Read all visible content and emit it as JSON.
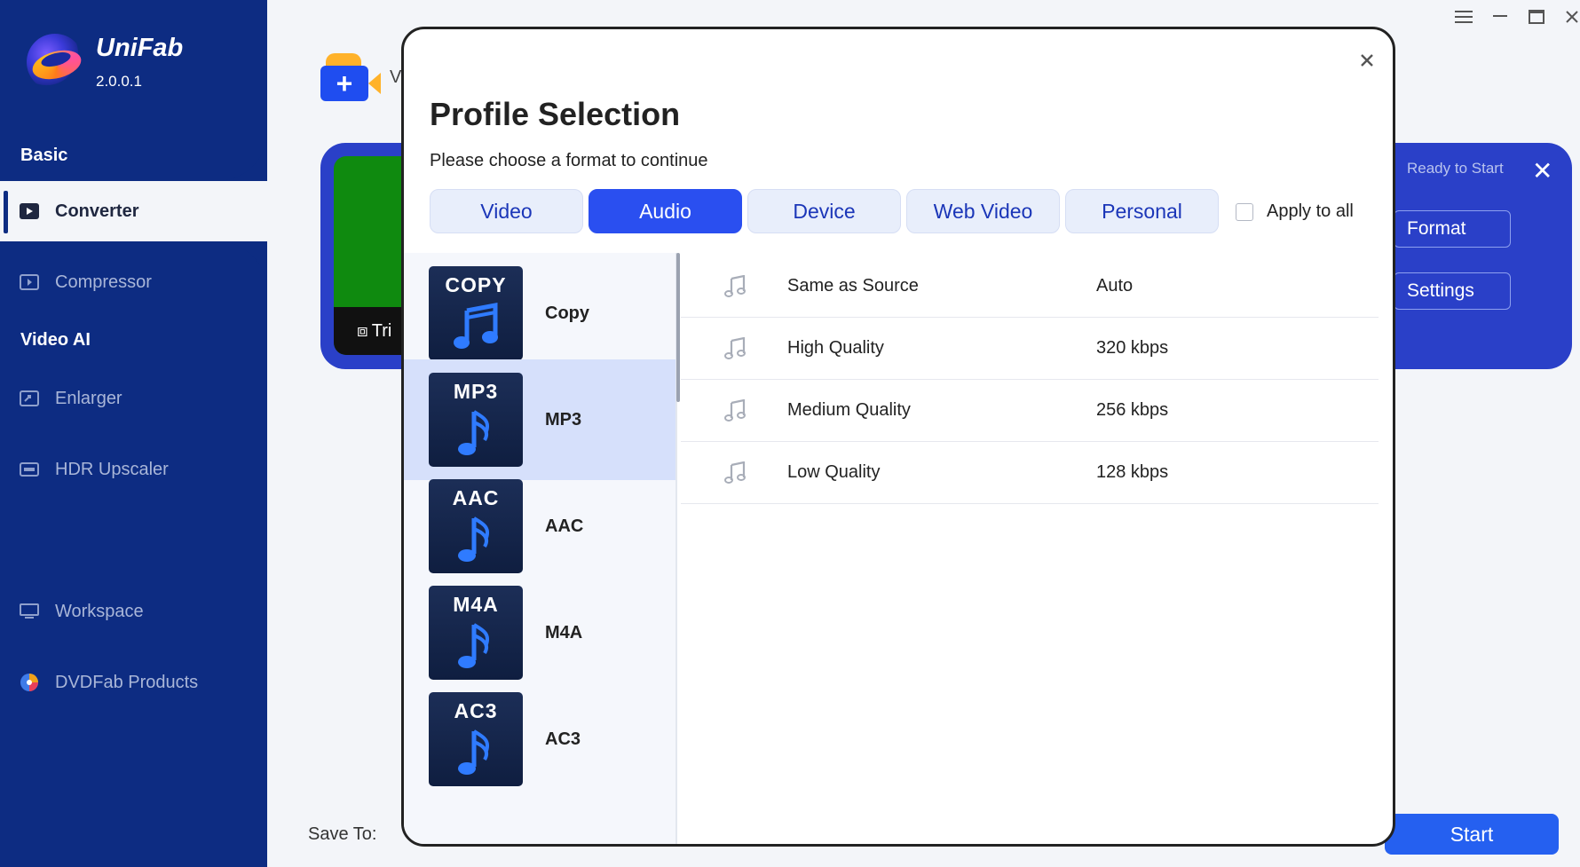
{
  "app": {
    "name": "UniFab",
    "version": "2.0.0.1"
  },
  "sidebar": {
    "sections": [
      {
        "title": "Basic",
        "items": [
          {
            "label": "Converter",
            "icon": "converter-icon"
          },
          {
            "label": "Compressor",
            "icon": "compressor-icon"
          }
        ]
      },
      {
        "title": "Video AI",
        "items": [
          {
            "label": "Enlarger",
            "icon": "enlarger-icon"
          },
          {
            "label": "HDR Upscaler",
            "icon": "hdr-icon"
          }
        ]
      }
    ],
    "bottom_items": [
      {
        "label": "Workspace",
        "icon": "monitor-icon"
      },
      {
        "label": "DVDFab Products",
        "icon": "dvdfab-icon"
      }
    ],
    "active": "Converter"
  },
  "main": {
    "add_label": "V",
    "thumb_label": "Tri",
    "status": "Ready to Start",
    "format_button": "Format",
    "settings_button": "Settings",
    "save_to_label": "Save To:",
    "start_button": "Start"
  },
  "modal": {
    "title": "Profile Selection",
    "subtitle": "Please choose a format to continue",
    "tabs": [
      "Video",
      "Audio",
      "Device",
      "Web Video",
      "Personal"
    ],
    "active_tab": "Audio",
    "apply_to_all": "Apply to all",
    "apply_to_all_checked": false,
    "formats": [
      {
        "badge": "COPY",
        "name": "Copy"
      },
      {
        "badge": "MP3",
        "name": "MP3",
        "selected": true
      },
      {
        "badge": "AAC",
        "name": "AAC"
      },
      {
        "badge": "M4A",
        "name": "M4A"
      },
      {
        "badge": "AC3",
        "name": "AC3"
      }
    ],
    "qualities": [
      {
        "name": "Same as Source",
        "bitrate": "Auto"
      },
      {
        "name": "High Quality",
        "bitrate": "320 kbps"
      },
      {
        "name": "Medium Quality",
        "bitrate": "256 kbps"
      },
      {
        "name": "Low Quality",
        "bitrate": "128 kbps"
      }
    ]
  },
  "colors": {
    "sidebar": "#0d2c82",
    "accent": "#2a4ff0",
    "selected_row": "#d6e0fb"
  }
}
